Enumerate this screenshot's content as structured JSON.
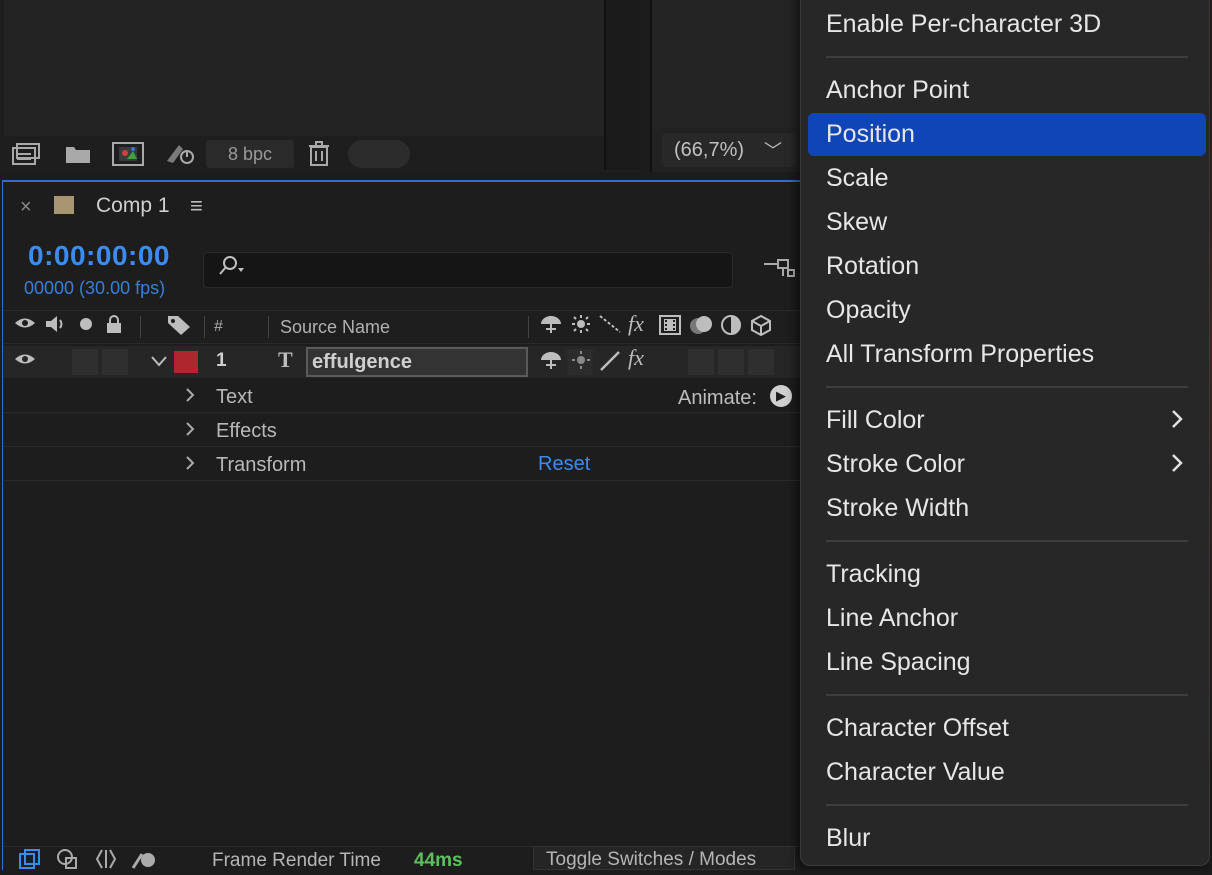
{
  "project_panel": {
    "bpc_label": "8 bpc"
  },
  "viewer": {
    "zoom_label": "(66,7%)",
    "zoom_chevron": "﹀"
  },
  "timeline": {
    "tab_close": "×",
    "tab_title": "Comp 1",
    "tab_menu": "≡",
    "timecode": "0:00:00:00",
    "frames_fps": "00000 (30.00 fps)",
    "header": {
      "num": "#",
      "source_name": "Source Name"
    },
    "layer": {
      "number": "1",
      "type_glyph": "T",
      "name": "effulgence",
      "label_color": "#b0262e"
    },
    "properties": [
      {
        "label": "Text"
      },
      {
        "label": "Effects"
      },
      {
        "label": "Transform"
      }
    ],
    "animate_label": "Animate:",
    "reset_label": "Reset",
    "status": {
      "frame_render_label": "Frame Render Time",
      "frame_render_value": "44ms",
      "toggle_modes": "Toggle Switches / Modes"
    }
  },
  "context_menu": {
    "items": [
      {
        "label": "Enable Per-character 3D"
      },
      {
        "label": "Anchor Point"
      },
      {
        "label": "Position",
        "highlighted": true
      },
      {
        "label": "Scale"
      },
      {
        "label": "Skew"
      },
      {
        "label": "Rotation"
      },
      {
        "label": "Opacity"
      },
      {
        "label": "All Transform Properties"
      },
      {
        "label": "Fill Color",
        "submenu": true
      },
      {
        "label": "Stroke Color",
        "submenu": true
      },
      {
        "label": "Stroke Width"
      },
      {
        "label": "Tracking"
      },
      {
        "label": "Line Anchor"
      },
      {
        "label": "Line Spacing"
      },
      {
        "label": "Character Offset"
      },
      {
        "label": "Character Value"
      },
      {
        "label": "Blur"
      }
    ],
    "highlight_color": "#1045b8"
  },
  "accent_color": "#3b8cf0"
}
